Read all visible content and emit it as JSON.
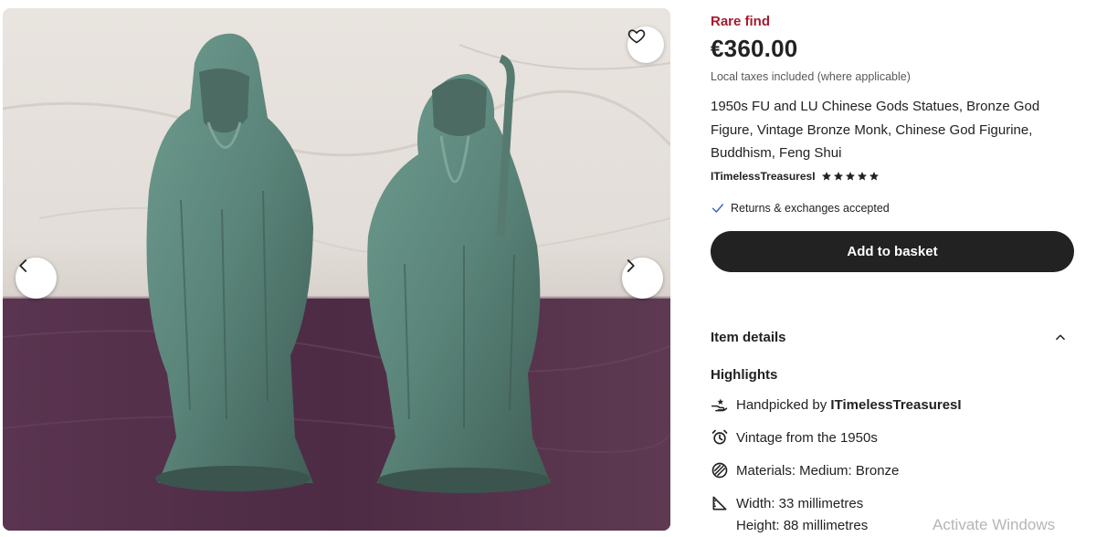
{
  "listing": {
    "rare_label": "Rare find",
    "price": "€360.00",
    "tax_note": "Local taxes included (where applicable)",
    "title": "1950s FU and LU Chinese Gods Statues, Bronze God Figure, Vintage Bronze Monk, Chinese God Figurine, Buddhism, Feng Shui",
    "shop_name": "ITimelessTreasuresI",
    "rating_stars": 5,
    "returns": "Returns & exchanges accepted",
    "add_to_basket": "Add to basket"
  },
  "details": {
    "section_label": "Item details",
    "highlights_label": "Highlights",
    "handpicked_prefix": "Handpicked by ",
    "handpicked_shop": "ITimelessTreasuresI",
    "vintage": "Vintage from the 1950s",
    "materials": "Materials: Medium: Bronze",
    "width": "Width: 33 millimetres",
    "height": "Height: 88 millimetres"
  },
  "icons": {
    "favorite": "heart-icon",
    "prev": "chevron-left-icon",
    "next": "chevron-right-icon",
    "check": "check-icon",
    "star": "star-icon",
    "collapse": "chevron-up-icon",
    "handpicked": "hand-icon",
    "vintage": "alarm-clock-icon",
    "materials": "materials-icon",
    "dimensions": "ruler-icon"
  },
  "colors": {
    "rare": "#a61a2e",
    "primary_button": "#222222",
    "check": "#3a63c7"
  },
  "system": {
    "watermark": "Activate Windows"
  }
}
